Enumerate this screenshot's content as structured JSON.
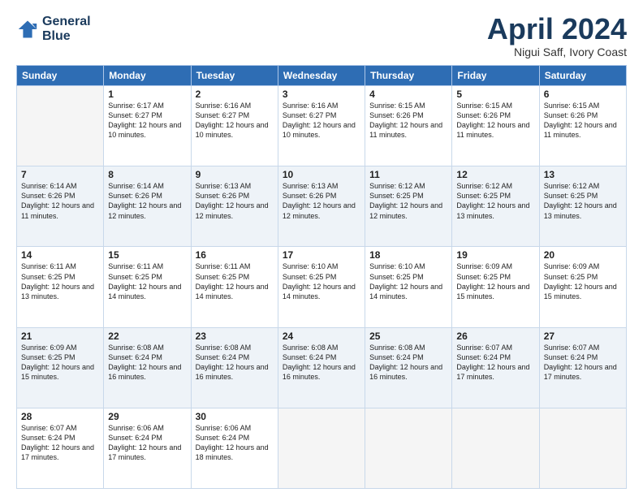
{
  "header": {
    "logo_line1": "General",
    "logo_line2": "Blue",
    "title": "April 2024",
    "location": "Nigui Saff, Ivory Coast"
  },
  "weekdays": [
    "Sunday",
    "Monday",
    "Tuesday",
    "Wednesday",
    "Thursday",
    "Friday",
    "Saturday"
  ],
  "weeks": [
    [
      {
        "day": null
      },
      {
        "day": "1",
        "sunrise": "6:17 AM",
        "sunset": "6:27 PM",
        "daylight": "12 hours and 10 minutes."
      },
      {
        "day": "2",
        "sunrise": "6:16 AM",
        "sunset": "6:27 PM",
        "daylight": "12 hours and 10 minutes."
      },
      {
        "day": "3",
        "sunrise": "6:16 AM",
        "sunset": "6:27 PM",
        "daylight": "12 hours and 10 minutes."
      },
      {
        "day": "4",
        "sunrise": "6:15 AM",
        "sunset": "6:26 PM",
        "daylight": "12 hours and 11 minutes."
      },
      {
        "day": "5",
        "sunrise": "6:15 AM",
        "sunset": "6:26 PM",
        "daylight": "12 hours and 11 minutes."
      },
      {
        "day": "6",
        "sunrise": "6:15 AM",
        "sunset": "6:26 PM",
        "daylight": "12 hours and 11 minutes."
      }
    ],
    [
      {
        "day": "7",
        "sunrise": "6:14 AM",
        "sunset": "6:26 PM",
        "daylight": "12 hours and 11 minutes."
      },
      {
        "day": "8",
        "sunrise": "6:14 AM",
        "sunset": "6:26 PM",
        "daylight": "12 hours and 12 minutes."
      },
      {
        "day": "9",
        "sunrise": "6:13 AM",
        "sunset": "6:26 PM",
        "daylight": "12 hours and 12 minutes."
      },
      {
        "day": "10",
        "sunrise": "6:13 AM",
        "sunset": "6:26 PM",
        "daylight": "12 hours and 12 minutes."
      },
      {
        "day": "11",
        "sunrise": "6:12 AM",
        "sunset": "6:25 PM",
        "daylight": "12 hours and 12 minutes."
      },
      {
        "day": "12",
        "sunrise": "6:12 AM",
        "sunset": "6:25 PM",
        "daylight": "12 hours and 13 minutes."
      },
      {
        "day": "13",
        "sunrise": "6:12 AM",
        "sunset": "6:25 PM",
        "daylight": "12 hours and 13 minutes."
      }
    ],
    [
      {
        "day": "14",
        "sunrise": "6:11 AM",
        "sunset": "6:25 PM",
        "daylight": "12 hours and 13 minutes."
      },
      {
        "day": "15",
        "sunrise": "6:11 AM",
        "sunset": "6:25 PM",
        "daylight": "12 hours and 14 minutes."
      },
      {
        "day": "16",
        "sunrise": "6:11 AM",
        "sunset": "6:25 PM",
        "daylight": "12 hours and 14 minutes."
      },
      {
        "day": "17",
        "sunrise": "6:10 AM",
        "sunset": "6:25 PM",
        "daylight": "12 hours and 14 minutes."
      },
      {
        "day": "18",
        "sunrise": "6:10 AM",
        "sunset": "6:25 PM",
        "daylight": "12 hours and 14 minutes."
      },
      {
        "day": "19",
        "sunrise": "6:09 AM",
        "sunset": "6:25 PM",
        "daylight": "12 hours and 15 minutes."
      },
      {
        "day": "20",
        "sunrise": "6:09 AM",
        "sunset": "6:25 PM",
        "daylight": "12 hours and 15 minutes."
      }
    ],
    [
      {
        "day": "21",
        "sunrise": "6:09 AM",
        "sunset": "6:25 PM",
        "daylight": "12 hours and 15 minutes."
      },
      {
        "day": "22",
        "sunrise": "6:08 AM",
        "sunset": "6:24 PM",
        "daylight": "12 hours and 16 minutes."
      },
      {
        "day": "23",
        "sunrise": "6:08 AM",
        "sunset": "6:24 PM",
        "daylight": "12 hours and 16 minutes."
      },
      {
        "day": "24",
        "sunrise": "6:08 AM",
        "sunset": "6:24 PM",
        "daylight": "12 hours and 16 minutes."
      },
      {
        "day": "25",
        "sunrise": "6:08 AM",
        "sunset": "6:24 PM",
        "daylight": "12 hours and 16 minutes."
      },
      {
        "day": "26",
        "sunrise": "6:07 AM",
        "sunset": "6:24 PM",
        "daylight": "12 hours and 17 minutes."
      },
      {
        "day": "27",
        "sunrise": "6:07 AM",
        "sunset": "6:24 PM",
        "daylight": "12 hours and 17 minutes."
      }
    ],
    [
      {
        "day": "28",
        "sunrise": "6:07 AM",
        "sunset": "6:24 PM",
        "daylight": "12 hours and 17 minutes."
      },
      {
        "day": "29",
        "sunrise": "6:06 AM",
        "sunset": "6:24 PM",
        "daylight": "12 hours and 17 minutes."
      },
      {
        "day": "30",
        "sunrise": "6:06 AM",
        "sunset": "6:24 PM",
        "daylight": "12 hours and 18 minutes."
      },
      {
        "day": null
      },
      {
        "day": null
      },
      {
        "day": null
      },
      {
        "day": null
      }
    ]
  ]
}
